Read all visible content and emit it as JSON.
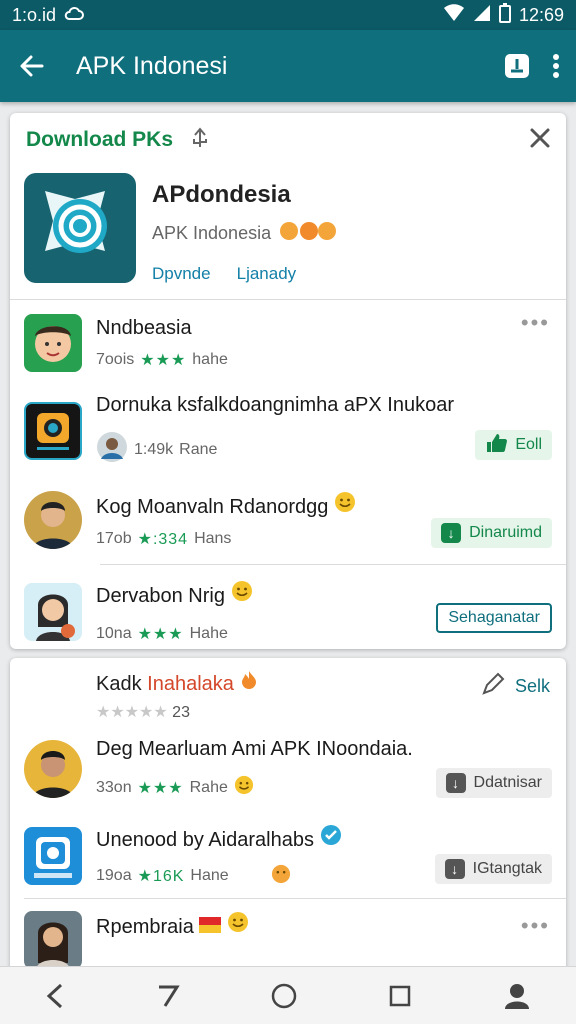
{
  "status": {
    "left_text": "1:o.id",
    "time": "12:69"
  },
  "appbar": {
    "title": "APK Indonesi"
  },
  "download_card": {
    "title": "Download PKs",
    "app_name": "APdondesia",
    "app_developer": "APK Indonesia",
    "link_1": "Dpvnde",
    "link_2": "Ljanady"
  },
  "list1": [
    {
      "title": "Nndbeasia",
      "meta": "7oois",
      "stars": "★★★",
      "tag": "hahe"
    },
    {
      "title": "Dornuka ksfalkdoangnimha aPX Inukoar",
      "meta": "1:49k",
      "tag": "Rane",
      "action": "Eoll"
    },
    {
      "title": "Kog Moanvaln Rdanordgg",
      "meta": "17ob",
      "stars": "★:334",
      "tag": "Hans",
      "action": "Dinaruimd"
    },
    {
      "title": "Dervabon Nrig",
      "meta": "10na",
      "stars": "★★★",
      "tag": "Hahe",
      "action": "Sehaganatar"
    }
  ],
  "section2": {
    "title_part1": "Kadk",
    "title_part2": "Inahalaka",
    "rating_stars": "★★★★★",
    "rating_count": "23",
    "edit_label": "Selk"
  },
  "list2": [
    {
      "title": "Deg Mearluam Ami APK INoondaia.",
      "meta": "33on",
      "stars": "★★★",
      "tag": "Rahe",
      "action": "Ddatnisar"
    },
    {
      "title": "Unenood by Aidaralhabs",
      "meta": "19oa",
      "stars": "★16K",
      "tag": "Hane",
      "action": "IGtangtak"
    },
    {
      "title": "Rpembraia",
      "meta": "",
      "stars": "",
      "tag": ""
    }
  ],
  "colors": {
    "primary": "#0f6f7d",
    "green": "#13884a",
    "accent": "#1380a8"
  }
}
